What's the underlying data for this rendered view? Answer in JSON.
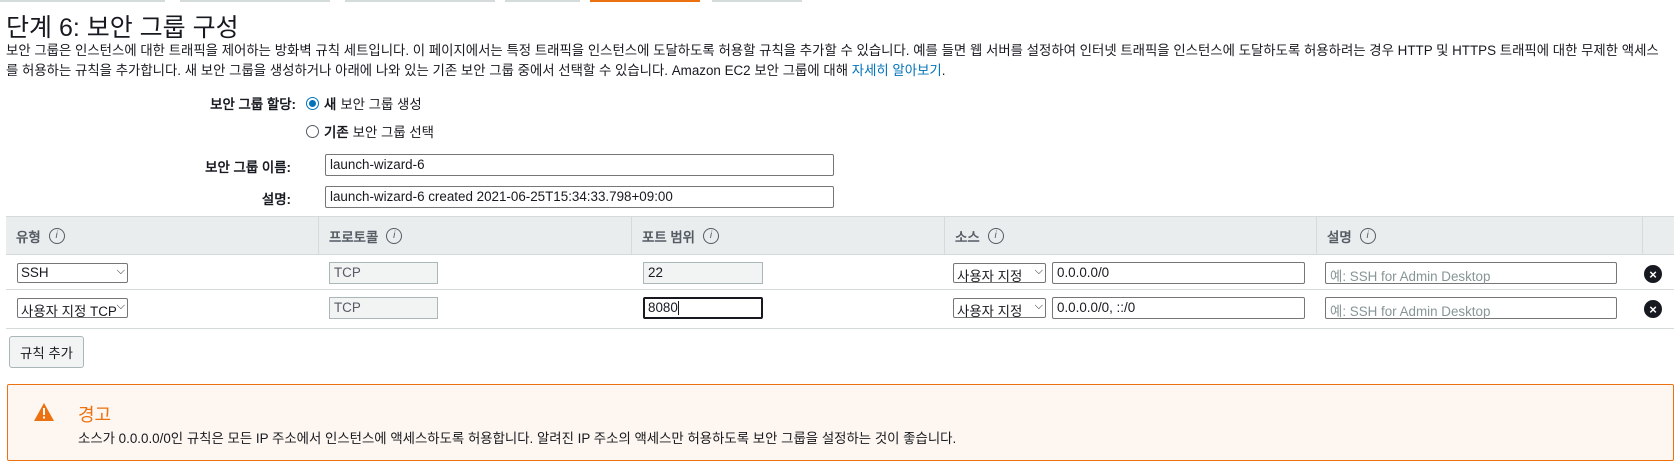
{
  "header": {
    "title": "단계 6: 보안 그룹 구성",
    "description": "보안 그룹은 인스턴스에 대한 트래픽을 제어하는 방화벽 규칙 세트입니다. 이 페이지에서는 특정 트래픽을 인스턴스에 도달하도록 허용할 규칙을 추가할 수 있습니다. 예를 들면 웹 서버를 설정하여 인터넷 트래픽을 인스턴스에 도달하도록 허용하려는 경우 HTTP 및 HTTPS 트래픽에 대한 무제한 액세스를 허용하는 규칙을 추가합니다. 새 보안 그룹을 생성하거나 아래에 나와 있는 기존 보안 그룹 중에서 선택할 수 있습니다. Amazon EC2 보안 그룹에 대해 ",
    "learn_more": "자세히 알아보기",
    "desc_end": "."
  },
  "assign": {
    "label": "보안 그룹 할당:",
    "option_new_bold": "새",
    "option_new_rest": "보안 그룹 생성",
    "option_existing_bold": "기존",
    "option_existing_rest": "보안 그룹 선택"
  },
  "name_field": {
    "label": "보안 그룹 이름:",
    "value": "launch-wizard-6"
  },
  "desc_field": {
    "label": "설명:",
    "value": "launch-wizard-6 created 2021-06-25T15:34:33.798+09:00"
  },
  "table": {
    "headers": [
      "유형",
      "프로토콜",
      "포트 범위",
      "소스",
      "설명"
    ],
    "info_glyph": "i",
    "rows": [
      {
        "type": "SSH",
        "protocol": "TCP",
        "port": "22",
        "source_type": "사용자 지정",
        "source": "0.0.0.0/0",
        "description_placeholder": "예: SSH for Admin Desktop"
      },
      {
        "type": "사용자 지정 TCP",
        "protocol": "TCP",
        "port": "8080",
        "source_type": "사용자 지정",
        "source": "0.0.0.0/0, ::/0",
        "description_placeholder": "예: SSH for Admin Desktop"
      }
    ]
  },
  "add_rule_label": "규칙 추가",
  "warning": {
    "title": "경고",
    "text": "소스가 0.0.0.0/0인 규칙은 모든 IP 주소에서 인스턴스에 액세스하도록 허용합니다. 알려진 IP 주소의 액세스만 허용하도록 보안 그룹을 설정하는 것이 좋습니다."
  },
  "colors": {
    "accent": "#ec7211",
    "link": "#0073bb",
    "header_bg": "#eaeded"
  },
  "icons": {
    "info": "info-icon",
    "remove": "close-circle-icon",
    "warning": "warning-triangle-icon",
    "dropdown": "chevron-down-icon"
  }
}
